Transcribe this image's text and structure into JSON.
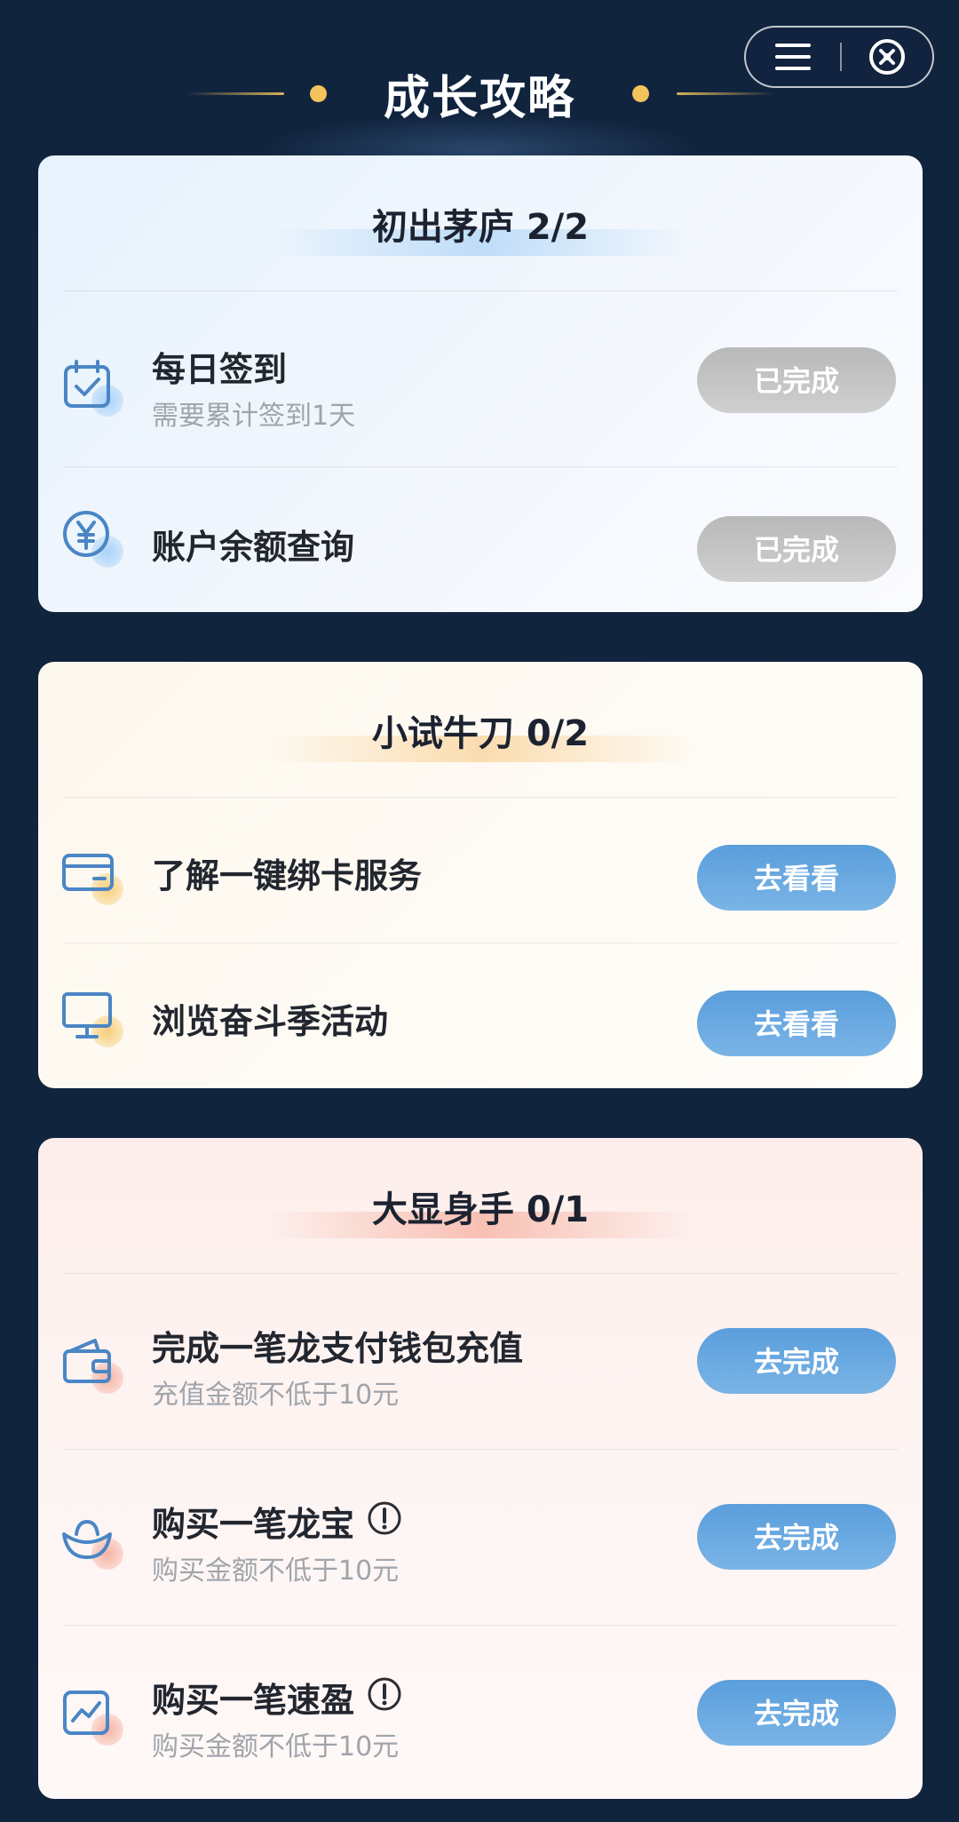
{
  "header": {
    "title": "成长攻略"
  },
  "capsule": {
    "menu_icon": "menu-icon",
    "close_icon": "close-circle-icon"
  },
  "sections": [
    {
      "title": "初出茅庐 2/2",
      "theme": "#9cc9f5",
      "tasks": [
        {
          "title": "每日签到",
          "subtitle": "需要累计签到1天",
          "action": "已完成",
          "status": "done",
          "icon": "calendar-check-icon"
        },
        {
          "title": "账户余额查询",
          "subtitle": "",
          "action": "已完成",
          "status": "done",
          "icon": "yuan-coin-icon"
        }
      ]
    },
    {
      "title": "小试牛刀 0/2",
      "theme": "#f6c87e",
      "tasks": [
        {
          "title": "了解一键绑卡服务",
          "subtitle": "",
          "action": "去看看",
          "status": "todo",
          "icon": "bank-card-icon"
        },
        {
          "title": "浏览奋斗季活动",
          "subtitle": "",
          "action": "去看看",
          "status": "todo",
          "icon": "monitor-icon"
        }
      ]
    },
    {
      "title": "大显身手 0/1",
      "theme": "#f4a898",
      "tasks": [
        {
          "title": "完成一笔龙支付钱包充值",
          "subtitle": "充值金额不低于10元",
          "action": "去完成",
          "status": "todo",
          "icon": "wallet-icon"
        },
        {
          "title": "购买一笔龙宝",
          "subtitle": "购买金额不低于10元",
          "action": "去完成",
          "status": "todo",
          "icon": "gold-ingot-icon",
          "info_icon": "info-icon"
        },
        {
          "title": "购买一笔速盈",
          "subtitle": "购买金额不低于10元",
          "action": "去完成",
          "status": "todo",
          "icon": "trend-chart-icon",
          "info_icon": "info-icon"
        }
      ]
    }
  ]
}
